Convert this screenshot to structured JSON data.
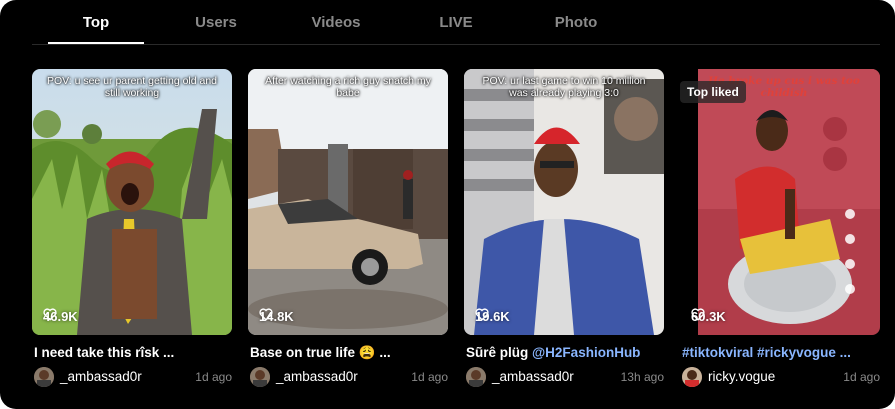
{
  "tabs": [
    {
      "label": "Top",
      "active": true
    },
    {
      "label": "Users"
    },
    {
      "label": "Videos"
    },
    {
      "label": "LIVE"
    },
    {
      "label": "Photo"
    }
  ],
  "videos": [
    {
      "overlay": "POV: u see ur parent getting old and still working",
      "likes": "46.9K",
      "title": "I need take this rîsk ...",
      "username": "_ambassad0r",
      "time": "1d ago"
    },
    {
      "overlay": "After watching a rich guy snatch my babe",
      "likes": "14.8K",
      "title": "Base on true life 😩 ...",
      "username": "_ambassad0r",
      "time": "1d ago"
    },
    {
      "overlay": "POV: ur last game to win 10 million was already playing 3:0",
      "likes": "19.6K",
      "title_text": "Sũrê plüg ",
      "title_mention": "@H2FashionHub",
      "username": "_ambassad0r",
      "time": "13h ago"
    },
    {
      "overlay": "He broke up cus i was too childish",
      "badge": "Top liked",
      "likes": "60.3K",
      "title": "#tiktokviral #rickyvogue ...",
      "username": "ricky.vogue",
      "time": "1d ago"
    }
  ],
  "colors": {
    "background": "#000000",
    "muted": "#8a8a8a",
    "link": "#8ab6ff"
  }
}
